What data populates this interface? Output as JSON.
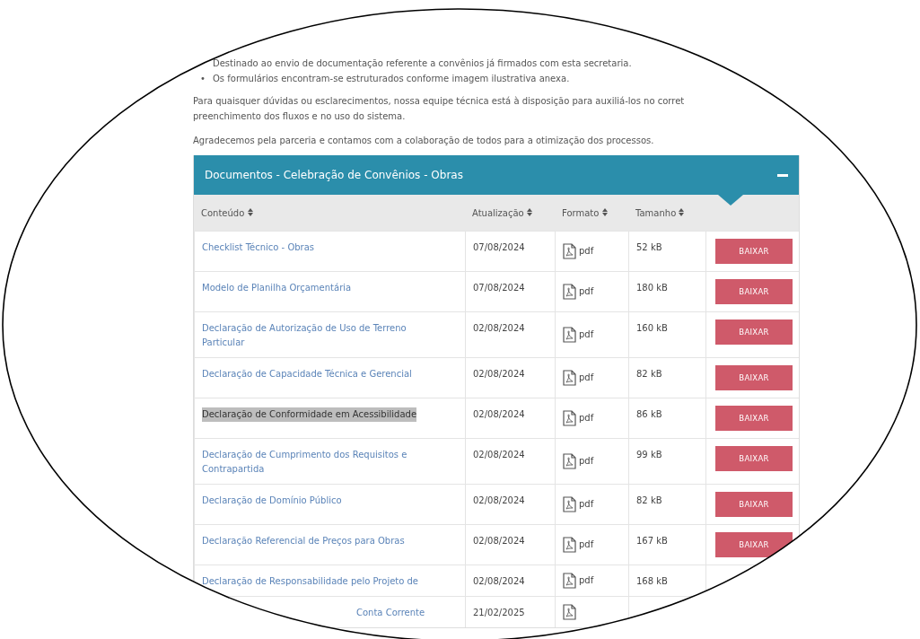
{
  "bullets": [
    {
      "text": "Destinado ao envio de documentação referente a convênios já firmados com esta secretaria."
    },
    {
      "marker": "•",
      "text": "Os formulários encontram-se estruturados conforme imagem ilustrativa anexa."
    }
  ],
  "paragraphs": [
    "Para quaisquer dúvidas ou esclarecimentos, nossa equipe técnica está à disposição para auxiliá-los no corret",
    "preenchimento dos fluxos e no uso do sistema.",
    "Agradecemos pela parceria e contamos com a colaboração de todos para a otimização dos processos."
  ],
  "panel": {
    "title": "Documentos - Celebração de Convênios - Obras",
    "expanded": true
  },
  "table": {
    "columns": [
      {
        "label": "Conteúdo",
        "sortable": true
      },
      {
        "label": "Atualização",
        "sortable": true
      },
      {
        "label": "Formato",
        "sortable": true
      },
      {
        "label": "Tamanho",
        "sortable": true
      },
      {}
    ],
    "rows": [
      {
        "name": "Checklist Técnico - Obras",
        "date": "07/08/2024",
        "format": "pdf",
        "size": "52 kB",
        "button": "BAIXAR",
        "highlighted": false
      },
      {
        "name": "Modelo de Planilha Orçamentária",
        "date": "07/08/2024",
        "format": "pdf",
        "size": "180 kB",
        "button": "BAIXAR",
        "highlighted": false
      },
      {
        "name": "Declaração de Autorização de Uso de Terreno Particular",
        "date": "02/08/2024",
        "format": "pdf",
        "size": "160 kB",
        "button": "BAIXAR",
        "highlighted": false
      },
      {
        "name": "Declaração de Capacidade Técnica e Gerencial",
        "date": "02/08/2024",
        "format": "pdf",
        "size": "82 kB",
        "button": "BAIXAR",
        "highlighted": false
      },
      {
        "name": "Declaração de Conformidade em Acessibilidade",
        "date": "02/08/2024",
        "format": "pdf",
        "size": "86 kB",
        "button": "BAIXAR",
        "highlighted": true
      },
      {
        "name": "Declaração de Cumprimento dos Requisitos e Contrapartida",
        "date": "02/08/2024",
        "format": "pdf",
        "size": "99 kB",
        "button": "BAIXAR",
        "highlighted": false
      },
      {
        "name": "Declaração de Domínio Público",
        "date": "02/08/2024",
        "format": "pdf",
        "size": "82 kB",
        "button": "BAIXAR",
        "highlighted": false
      },
      {
        "name": "Declaração Referencial de Preços para Obras",
        "date": "02/08/2024",
        "format": "pdf",
        "size": "167 kB",
        "button": "BAIXAR",
        "highlighted": false
      },
      {
        "name": "Declaração de Responsabilidade pelo Projeto de",
        "date": "02/08/2024",
        "format": "pdf",
        "size": "168 kB",
        "highlighted": false
      },
      {
        "name": "Conta Corrente",
        "name_offset": true,
        "date": "21/02/2025",
        "highlighted": false
      }
    ]
  }
}
